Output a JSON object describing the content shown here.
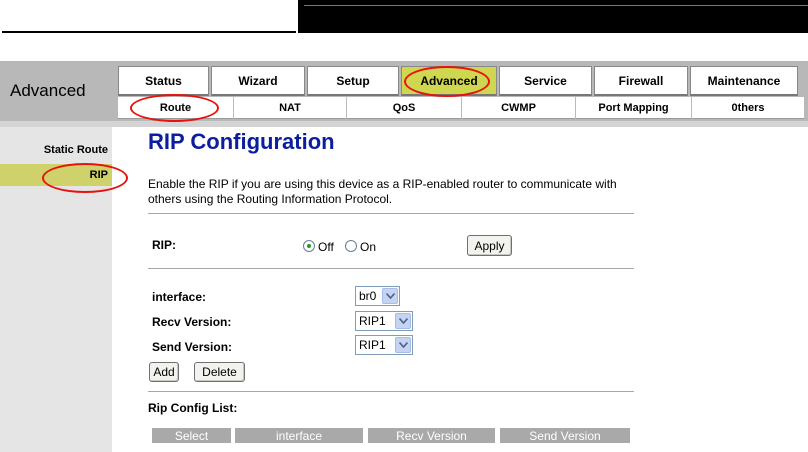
{
  "header": {
    "section_title": "Advanced"
  },
  "main_tabs": [
    {
      "label": "Status",
      "active": false
    },
    {
      "label": "Wizard",
      "active": false
    },
    {
      "label": "Setup",
      "active": false
    },
    {
      "label": "Advanced",
      "active": true
    },
    {
      "label": "Service",
      "active": false
    },
    {
      "label": "Firewall",
      "active": false
    },
    {
      "label": "Maintenance",
      "active": false
    }
  ],
  "sub_tabs": [
    {
      "label": "Route",
      "active": true
    },
    {
      "label": "NAT"
    },
    {
      "label": "QoS"
    },
    {
      "label": "CWMP"
    },
    {
      "label": "Port Mapping"
    },
    {
      "label": "0thers"
    }
  ],
  "sidebar": {
    "items": [
      {
        "label": "Static Route",
        "active": false
      },
      {
        "label": "RIP",
        "active": true
      }
    ]
  },
  "page": {
    "title": "RIP Configuration",
    "description": "Enable the RIP if you are using this device as a RIP-enabled router to communicate with others using the Routing Information Protocol."
  },
  "rip": {
    "label": "RIP:",
    "options": [
      {
        "label": "Off",
        "selected": true
      },
      {
        "label": "On",
        "selected": false
      }
    ],
    "apply_label": "Apply"
  },
  "form": {
    "interface_label": "interface:",
    "interface_value": "br0",
    "recv_label": "Recv Version:",
    "recv_value": "RIP1",
    "send_label": "Send Version:",
    "send_value": "RIP1",
    "add_label": "Add",
    "delete_label": "Delete"
  },
  "config_list": {
    "title": "Rip Config List:",
    "columns": [
      "Select",
      "interface",
      "Recv Version",
      "Send Version"
    ]
  },
  "colors": {
    "active_tab": "#cfd64f",
    "title_blue": "#0b1e9e",
    "annotation_red": "#e8120c"
  }
}
